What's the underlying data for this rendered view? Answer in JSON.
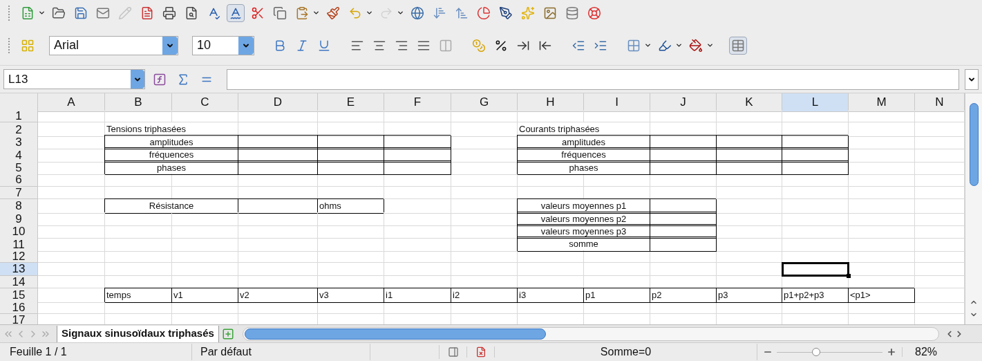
{
  "toolbar": {
    "font_name": {
      "value": "Arial"
    },
    "font_size": {
      "value": "10"
    }
  },
  "formula_bar": {
    "name_box": "L13"
  },
  "columns": [
    {
      "label": "A",
      "selected": false
    },
    {
      "label": "B",
      "selected": false
    },
    {
      "label": "C",
      "selected": false
    },
    {
      "label": "D",
      "selected": false
    },
    {
      "label": "E",
      "selected": false
    },
    {
      "label": "F",
      "selected": false
    },
    {
      "label": "G",
      "selected": false
    },
    {
      "label": "H",
      "selected": false
    },
    {
      "label": "I",
      "selected": false
    },
    {
      "label": "J",
      "selected": false
    },
    {
      "label": "K",
      "selected": false
    },
    {
      "label": "L",
      "selected": true
    },
    {
      "label": "M",
      "selected": false
    },
    {
      "label": "N",
      "selected": false
    }
  ],
  "rows": [
    {
      "label": "1",
      "selected": false
    },
    {
      "label": "2",
      "selected": false,
      "cells": [
        {
          "bordered": false,
          "selected": false
        },
        {
          "text": "Tensions triphasées",
          "centered": false,
          "merged": true,
          "bordered": false,
          "selected": false
        },
        {
          "bordered": false,
          "selected": false
        },
        {
          "bordered": false,
          "selected": false
        },
        {
          "bordered": false,
          "selected": false
        },
        {
          "bordered": false,
          "selected": false
        },
        {
          "text": "Courants triphasées",
          "centered": false,
          "merged": true,
          "bordered": false,
          "selected": false
        }
      ]
    },
    {
      "label": "3",
      "selected": false,
      "cells": [
        {
          "bordered": false,
          "selected": false
        },
        {
          "text": "amplitudes",
          "centered": true,
          "merged": true,
          "bordered": true,
          "selected": false
        },
        {
          "bordered": true,
          "selected": false
        },
        {
          "bordered": true,
          "selected": false
        },
        {
          "bordered": true,
          "selected": false
        },
        {
          "bordered": false,
          "selected": false
        },
        {
          "text": "amplitudes",
          "centered": true,
          "merged": true,
          "bordered": true,
          "selected": false
        },
        {
          "bordered": true,
          "selected": false
        },
        {
          "bordered": true,
          "selected": false
        },
        {
          "bordered": true,
          "selected": false
        }
      ]
    },
    {
      "label": "4",
      "selected": false,
      "cells": [
        {
          "bordered": false,
          "selected": false
        },
        {
          "text": "fréquences",
          "centered": true,
          "merged": true,
          "bordered": true,
          "selected": false
        },
        {
          "bordered": true,
          "selected": false
        },
        {
          "bordered": true,
          "selected": false
        },
        {
          "bordered": true,
          "selected": false
        },
        {
          "bordered": false,
          "selected": false
        },
        {
          "text": "fréquences",
          "centered": true,
          "merged": true,
          "bordered": true,
          "selected": false
        },
        {
          "bordered": true,
          "selected": false
        },
        {
          "bordered": true,
          "selected": false
        },
        {
          "bordered": true,
          "selected": false
        }
      ]
    },
    {
      "label": "5",
      "selected": false,
      "cells": [
        {
          "bordered": false,
          "selected": false
        },
        {
          "text": "phases",
          "centered": true,
          "merged": true,
          "bordered": true,
          "selected": false
        },
        {
          "bordered": true,
          "selected": false
        },
        {
          "bordered": true,
          "selected": false
        },
        {
          "bordered": true,
          "selected": false
        },
        {
          "bordered": false,
          "selected": false
        },
        {
          "text": "phases",
          "centered": true,
          "merged": true,
          "bordered": true,
          "selected": false
        },
        {
          "bordered": true,
          "selected": false
        },
        {
          "bordered": true,
          "selected": false
        },
        {
          "bordered": true,
          "selected": false
        }
      ]
    },
    {
      "label": "6",
      "selected": false
    },
    {
      "label": "7",
      "selected": false
    },
    {
      "label": "8",
      "selected": false,
      "cells": [
        {
          "bordered": false,
          "selected": false
        },
        {
          "text": "Résistance",
          "centered": true,
          "merged": true,
          "bordered": true,
          "selected": false
        },
        {
          "bordered": true,
          "selected": false
        },
        {
          "text": "ohms",
          "centered": false,
          "bordered": true,
          "selected": false
        },
        {
          "bordered": false,
          "selected": false
        },
        {
          "bordered": false,
          "selected": false
        },
        {
          "text": "valeurs moyennes p1",
          "centered": true,
          "merged": true,
          "bordered": true,
          "selected": false
        },
        {
          "bordered": true,
          "selected": false
        }
      ]
    },
    {
      "label": "9",
      "selected": false,
      "cells": [
        {
          "bordered": false,
          "selected": false
        },
        {
          "bordered": false,
          "selected": false
        },
        {
          "bordered": false,
          "selected": false
        },
        {
          "bordered": false,
          "selected": false
        },
        {
          "bordered": false,
          "selected": false
        },
        {
          "bordered": false,
          "selected": false
        },
        {
          "bordered": false,
          "selected": false
        },
        {
          "text": "valeurs moyennes p2",
          "centered": true,
          "merged": true,
          "bordered": true,
          "selected": false
        },
        {
          "bordered": true,
          "selected": false
        }
      ]
    },
    {
      "label": "10",
      "selected": false,
      "cells": [
        {
          "bordered": false,
          "selected": false
        },
        {
          "bordered": false,
          "selected": false
        },
        {
          "bordered": false,
          "selected": false
        },
        {
          "bordered": false,
          "selected": false
        },
        {
          "bordered": false,
          "selected": false
        },
        {
          "bordered": false,
          "selected": false
        },
        {
          "bordered": false,
          "selected": false
        },
        {
          "text": "valeurs moyennes p3",
          "centered": true,
          "merged": true,
          "bordered": true,
          "selected": false
        },
        {
          "bordered": true,
          "selected": false
        }
      ]
    },
    {
      "label": "11",
      "selected": false,
      "cells": [
        {
          "bordered": false,
          "selected": false
        },
        {
          "bordered": false,
          "selected": false
        },
        {
          "bordered": false,
          "selected": false
        },
        {
          "bordered": false,
          "selected": false
        },
        {
          "bordered": false,
          "selected": false
        },
        {
          "bordered": false,
          "selected": false
        },
        {
          "bordered": false,
          "selected": false
        },
        {
          "text": "somme",
          "centered": true,
          "merged": true,
          "bordered": true,
          "selected": false
        },
        {
          "bordered": true,
          "selected": false
        }
      ]
    },
    {
      "label": "12",
      "selected": false
    },
    {
      "label": "13",
      "selected": true,
      "cells": [
        {
          "bordered": false,
          "selected": false
        },
        {
          "bordered": false,
          "selected": false
        },
        {
          "bordered": false,
          "selected": false
        },
        {
          "bordered": false,
          "selected": false
        },
        {
          "bordered": false,
          "selected": false
        },
        {
          "bordered": false,
          "selected": false
        },
        {
          "bordered": false,
          "selected": false
        },
        {
          "bordered": false,
          "selected": false
        },
        {
          "bordered": false,
          "selected": false
        },
        {
          "bordered": false,
          "selected": false
        },
        {
          "bordered": false,
          "selected": false
        },
        {
          "bordered": false,
          "selected": true
        }
      ]
    },
    {
      "label": "14",
      "selected": false
    },
    {
      "label": "15",
      "selected": false,
      "cells": [
        {
          "bordered": false,
          "selected": false
        },
        {
          "text": "temps",
          "centered": false,
          "bordered": true,
          "selected": false
        },
        {
          "text": "v1",
          "centered": false,
          "bordered": true,
          "selected": false
        },
        {
          "text": "v2",
          "centered": false,
          "bordered": true,
          "selected": false
        },
        {
          "text": "v3",
          "centered": false,
          "bordered": true,
          "selected": false
        },
        {
          "text": "i1",
          "centered": false,
          "bordered": true,
          "selected": false
        },
        {
          "text": "i2",
          "centered": false,
          "bordered": true,
          "selected": false
        },
        {
          "text": "i3",
          "centered": false,
          "bordered": true,
          "selected": false
        },
        {
          "text": "p1",
          "centered": false,
          "bordered": true,
          "selected": false
        },
        {
          "text": "p2",
          "centered": false,
          "bordered": true,
          "selected": false
        },
        {
          "text": "p3",
          "centered": false,
          "bordered": true,
          "selected": false
        },
        {
          "text": "p1+p2+p3",
          "centered": false,
          "bordered": true,
          "selected": false
        },
        {
          "text": "<p1>",
          "centered": false,
          "bordered": true,
          "selected": false
        }
      ]
    },
    {
      "label": "16",
      "selected": false
    },
    {
      "label": "17",
      "selected": false
    }
  ],
  "sheet_tabs": [
    {
      "label": "Signaux sinusoïdaux triphasés",
      "selected": true
    }
  ],
  "status_bar": {
    "sheet": "Feuille 1 / 1",
    "page_style": "Par défaut",
    "sum": "Somme=0",
    "zoom": {
      "level": 0.37,
      "reading": "82%"
    }
  }
}
